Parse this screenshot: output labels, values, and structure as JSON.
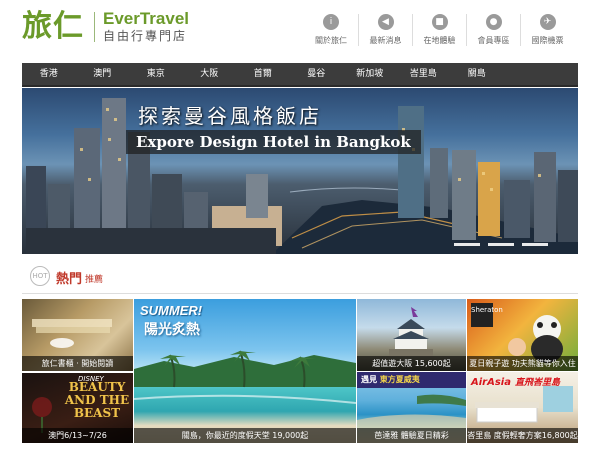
{
  "brand": {
    "name_cn": "旅仁",
    "name_en": "EverTravel",
    "tagline": "自由行專門店",
    "accent_color": "#6b9a2a"
  },
  "top_nav": [
    {
      "label": "關於旅仁",
      "icon": "info-icon"
    },
    {
      "label": "最新消息",
      "icon": "megaphone-icon"
    },
    {
      "label": "在地體驗",
      "icon": "suitcase-icon"
    },
    {
      "label": "會員專區",
      "icon": "person-icon"
    },
    {
      "label": "國際機票",
      "icon": "ticket-icon"
    }
  ],
  "main_nav": [
    "香港",
    "澳門",
    "東京",
    "大阪",
    "首爾",
    "曼谷",
    "新加坡",
    "峇里島",
    "關島"
  ],
  "hero": {
    "title_cn": "探索曼谷風格飯店",
    "title_en": "Expore Design Hotel in Bangkok"
  },
  "section": {
    "title": "熱門",
    "subtitle": "推薦",
    "badge": "HOT"
  },
  "tiles": {
    "books": {
      "caption": "旅仁書櫃 · 開始閱讀"
    },
    "beauty": {
      "caption": "澳門6/13~7/26",
      "disney": "DISNEY",
      "title": "BEAUTY AND THE BEAST"
    },
    "island": {
      "caption": "關島，你最近的度假天堂 19,000起",
      "headline": "SUMMER!",
      "subline": "陽光炙熱"
    },
    "osaka": {
      "caption": "超值遊大阪 15,600起"
    },
    "family": {
      "caption": "夏日親子遊 功夫熊貓等你入住",
      "logo": "Sheraton"
    },
    "hawaii": {
      "caption": "芭達雅 體驗夏日精彩",
      "band_a": "遇見",
      "band_b": "東方夏威夷"
    },
    "airasia": {
      "caption": "峇里島 度假輕奢方案16,800起",
      "brand": "AirAsia",
      "brand_sub": "直飛峇里島"
    }
  }
}
